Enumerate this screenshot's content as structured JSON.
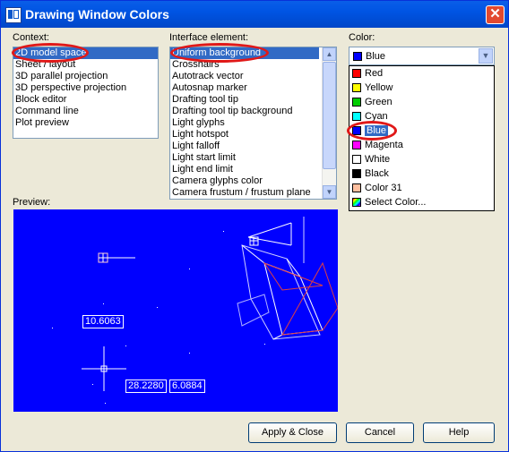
{
  "window": {
    "title": "Drawing Window Colors"
  },
  "context": {
    "label": "Context:",
    "items": [
      "2D model space",
      "Sheet / layout",
      "3D parallel projection",
      "3D perspective projection",
      "Block editor",
      "Command line",
      "Plot preview"
    ],
    "selected_index": 0
  },
  "interface": {
    "label": "Interface element:",
    "items": [
      "Uniform background",
      "Crosshairs",
      "Autotrack vector",
      "Autosnap marker",
      "Drafting tool tip",
      "Drafting tool tip background",
      "Light glyphs",
      "Light hotspot",
      "Light falloff",
      "Light start limit",
      "Light end limit",
      "Camera glyphs color",
      "Camera frustum / frustum plane"
    ],
    "selected_index": 0
  },
  "color": {
    "label": "Color:",
    "value": "Blue",
    "value_hex": "#0000ff",
    "options": [
      {
        "label": "Red",
        "hex": "#ff0000"
      },
      {
        "label": "Yellow",
        "hex": "#ffff00"
      },
      {
        "label": "Green",
        "hex": "#00cc00"
      },
      {
        "label": "Cyan",
        "hex": "#00ffff"
      },
      {
        "label": "Blue",
        "hex": "#0000ff"
      },
      {
        "label": "Magenta",
        "hex": "#ff00ff"
      },
      {
        "label": "White",
        "hex": "#ffffff"
      },
      {
        "label": "Black",
        "hex": "#000000"
      },
      {
        "label": "Color 31",
        "hex": "#ffbf9f"
      },
      {
        "label": "Select Color...",
        "hex": "multi"
      }
    ],
    "selected_index": 4
  },
  "preview": {
    "label": "Preview:",
    "background": "#0000ff",
    "dimension_1": "10.6063",
    "dimension_2": "28.2280",
    "dimension_3": "6.0884"
  },
  "buttons": {
    "apply": "Apply & Close",
    "cancel": "Cancel",
    "help": "Help"
  }
}
